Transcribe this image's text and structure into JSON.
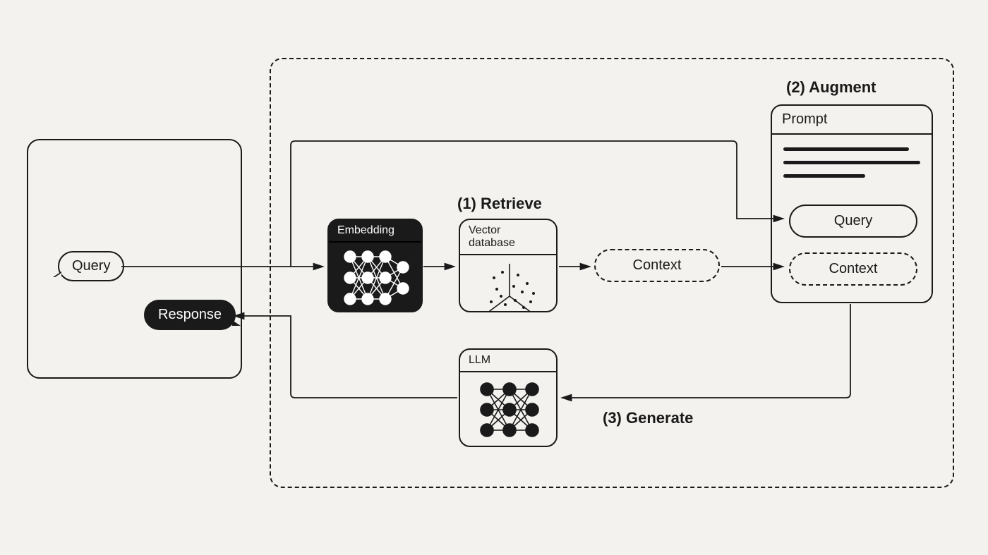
{
  "chat": {
    "query_label": "Query",
    "response_label": "Response"
  },
  "stages": {
    "retrieve": "(1) Retrieve",
    "augment": "(2) Augment",
    "generate": "(3) Generate"
  },
  "cards": {
    "embedding": "Embedding",
    "vector_db": "Vector database",
    "llm": "LLM"
  },
  "context_pill": "Context",
  "prompt": {
    "title": "Prompt",
    "query_pill": "Query",
    "context_pill": "Context"
  }
}
